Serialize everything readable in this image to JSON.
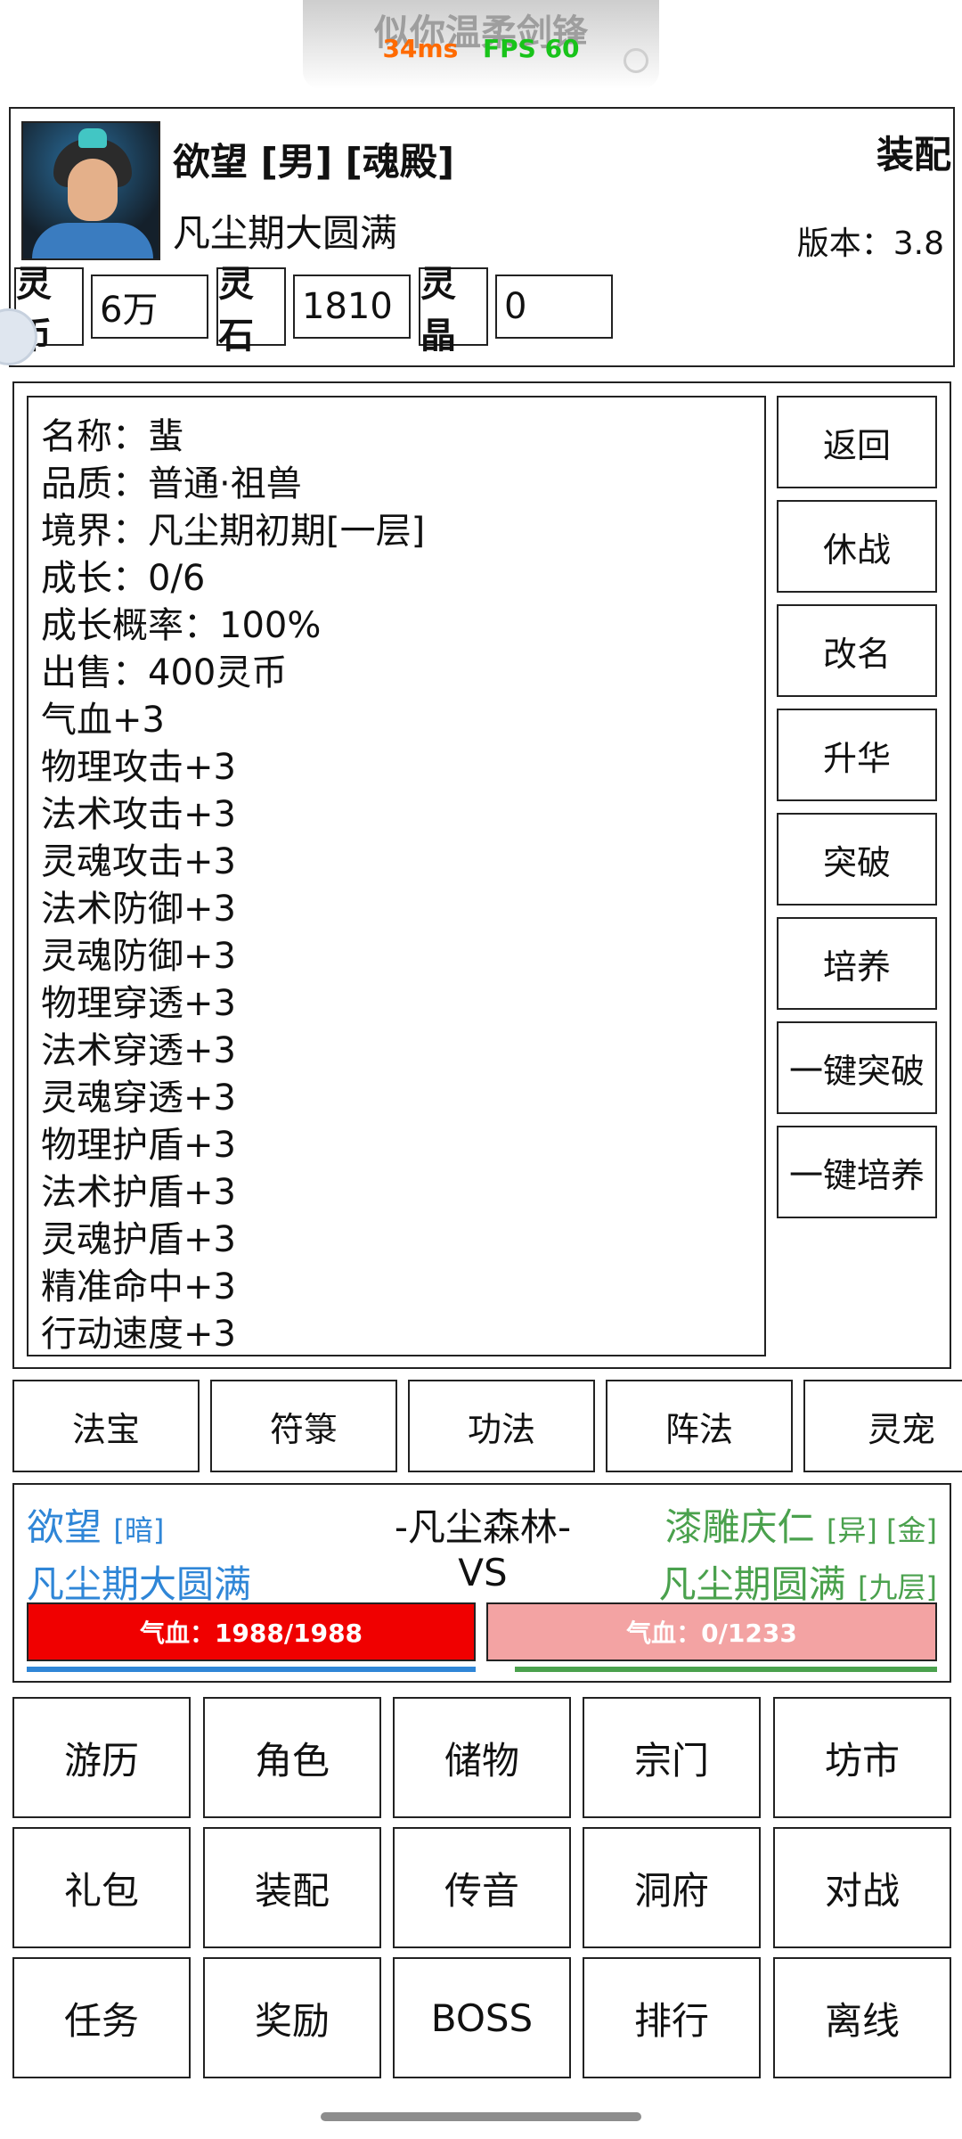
{
  "overlay": {
    "title": "似你温柔剑锋",
    "signal": "34ms",
    "fps": "FPS 60"
  },
  "player": {
    "name": "欲望",
    "gender": "[男]",
    "faction": "[魂殿]",
    "realm": "凡尘期大圆满",
    "equip_label": "装配",
    "version": "版本：3.8"
  },
  "currencies": [
    {
      "label": "灵币",
      "value": "6万"
    },
    {
      "label": "灵石",
      "value": "1810"
    },
    {
      "label": "灵晶",
      "value": "0"
    }
  ],
  "detail": {
    "lines": [
      "名称：蜚",
      "品质：普通·祖兽",
      "境界：凡尘期初期[一层]",
      "成长：0/6",
      "成长概率：100%",
      "出售：400灵币",
      "气血+3",
      "物理攻击+3",
      "法术攻击+3",
      "灵魂攻击+3",
      "法术防御+3",
      "灵魂防御+3",
      "物理穿透+3",
      "法术穿透+3",
      "灵魂穿透+3",
      "物理护盾+3",
      "法术护盾+3",
      "灵魂护盾+3",
      "精准命中+3",
      "行动速度+3"
    ]
  },
  "side_buttons": [
    "返回",
    "休战",
    "改名",
    "升华",
    "突破",
    "培养",
    "一键突破",
    "一键培养"
  ],
  "tabs": [
    "法宝",
    "符箓",
    "功法",
    "阵法",
    "灵宠"
  ],
  "battle": {
    "left": {
      "name": "欲望",
      "tag": "[暗]",
      "realm": "凡尘期大圆满",
      "hp_text": "气血：1988/1988",
      "hp_fraction": 1.0
    },
    "location": "-凡尘森林-",
    "vs": "VS",
    "right": {
      "name": "漆雕庆仁",
      "tags": "[异] [金]",
      "realm": "凡尘期圆满",
      "realm_tag": "[九层]",
      "hp_text": "气血：0/1233",
      "hp_fraction": 0.0
    }
  },
  "menu": [
    [
      "游历",
      "角色",
      "储物",
      "宗门",
      "坊市"
    ],
    [
      "礼包",
      "装配",
      "传音",
      "洞府",
      "对战"
    ],
    [
      "任务",
      "奖励",
      "BOSS",
      "排行",
      "离线"
    ]
  ],
  "colors": {
    "ally": "#2f86d7",
    "enemy": "#4aa14d",
    "hp_full": "#f00000",
    "hp_empty": "#f3a3a3"
  }
}
